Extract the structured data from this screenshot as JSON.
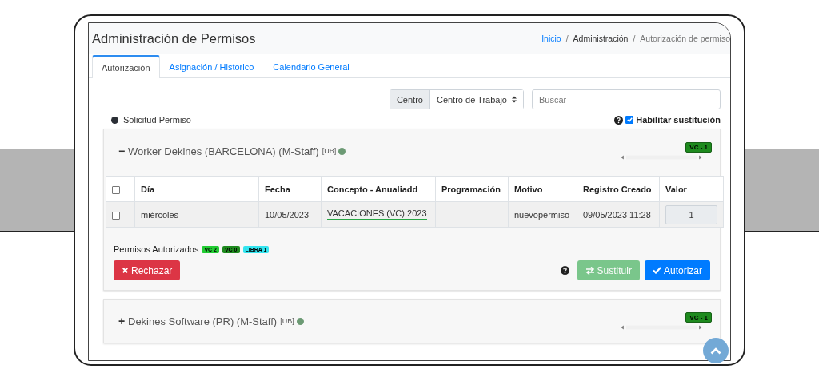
{
  "header": {
    "title": "Administración de Permisos",
    "separator": "/",
    "breadcrumb": [
      {
        "label": "Inicio",
        "link": true
      },
      {
        "label": "Administración",
        "link": false
      },
      {
        "label": "Autorización de permiso",
        "link": false
      }
    ]
  },
  "tabs": [
    {
      "label": "Autorización",
      "selected": true
    },
    {
      "label": "Asignación / Historico",
      "selected": false
    },
    {
      "label": "Calendario General",
      "selected": false
    }
  ],
  "filter": {
    "group_label": "Centro",
    "select_value": "Centro de Trabajo",
    "search_placeholder": "Buscar"
  },
  "legend": {
    "label": "Solicitud Permiso"
  },
  "substitution": {
    "label": "Habilitar sustitución",
    "checked": true
  },
  "panels": [
    {
      "toggle": "−",
      "name": "Worker Dekines (BARCELONA) (M-Staff)",
      "tag": "[UB]",
      "badge": "VC - 1",
      "table": {
        "header_checked": false,
        "columns": [
          "Día",
          "Fecha",
          "Concepto - Anualiadd",
          "Programación",
          "Motivo",
          "Registro Creado",
          "Valor"
        ],
        "rows": [
          {
            "checked": false,
            "cells": [
              "miércoles",
              "10/05/2023",
              "VACACIONES (VC) 2023",
              "",
              "nuevopermiso",
              "09/05/2023 11:28"
            ],
            "value": "1"
          }
        ]
      },
      "footer": {
        "label": "Permisos Autorizados",
        "badges": [
          {
            "text": "VC 2",
            "color": "#22cc33"
          },
          {
            "text": "VC 0",
            "color": "#1e8a1e"
          },
          {
            "text": "LIBRA 1",
            "color": "#33e5f0"
          }
        ],
        "buttons": [
          {
            "label": "Rechazar",
            "kind": "reject",
            "disabled": false
          },
          {
            "label": "Sustituir",
            "kind": "swap",
            "disabled": true
          },
          {
            "label": "Autorizar",
            "kind": "approve",
            "disabled": false
          }
        ]
      }
    },
    {
      "toggle": "+",
      "name": "Dekines Software (PR) (M-Staff)",
      "tag": "[UB]",
      "badge": "VC - 1"
    }
  ]
}
